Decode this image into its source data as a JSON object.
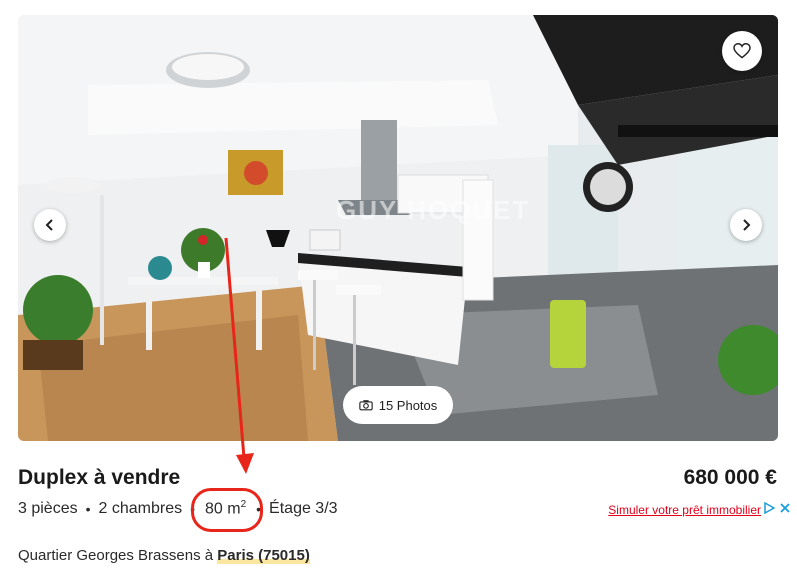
{
  "listing": {
    "title": "Duplex à vendre",
    "price": "680 000 €",
    "rooms": "3 pièces",
    "bedrooms": "2 chambres",
    "area_value": "80 m",
    "area_unit_sup": "2",
    "floor": "Étage 3/3",
    "simulate_link": "Simuler votre prêt immobilier",
    "location_prefix": "Quartier Georges Brassens à ",
    "location_city": "Paris (75015)"
  },
  "gallery": {
    "photo_count": "15 Photos",
    "watermark": "GUY HOQUET"
  },
  "icons": {
    "favorite": "heart-icon",
    "prev": "chevron-left-icon",
    "next": "chevron-right-icon",
    "camera": "camera-icon",
    "ad_choices": "adchoices-icon",
    "ad_close": "close-icon"
  },
  "colors": {
    "annotation_red": "#e8251a",
    "link_red": "#e2001a",
    "highlight": "#fbe6a0"
  }
}
